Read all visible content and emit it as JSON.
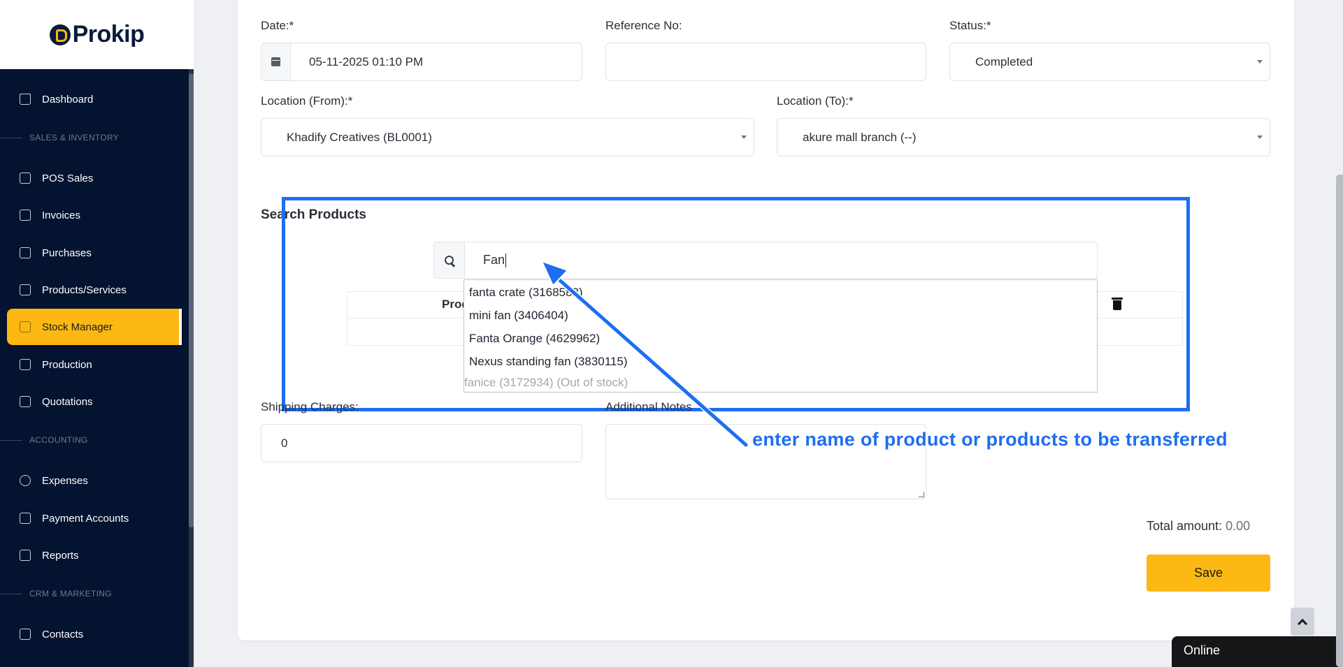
{
  "brand": {
    "name": "Prokip",
    "accent": "#fdb813",
    "sidebar_bg": "#04132f",
    "annotation_color": "#1e6ef0"
  },
  "sidebar": {
    "items": [
      {
        "label": "Dashboard",
        "icon": "home-icon"
      },
      {
        "label": "POS Sales",
        "icon": "shopping-bag-icon"
      },
      {
        "label": "Invoices",
        "icon": "invoice-icon"
      },
      {
        "label": "Purchases",
        "icon": "package-icon"
      },
      {
        "label": "Products/Services",
        "icon": "cube-icon"
      },
      {
        "label": "Stock Manager",
        "icon": "clipboard-icon",
        "active": true
      },
      {
        "label": "Production",
        "icon": "factory-icon"
      },
      {
        "label": "Quotations",
        "icon": "document-icon"
      },
      {
        "label": "Expenses",
        "icon": "pie-chart-icon"
      },
      {
        "label": "Payment Accounts",
        "icon": "credit-card-icon"
      },
      {
        "label": "Reports",
        "icon": "presentation-icon"
      },
      {
        "label": "Contacts",
        "icon": "contacts-icon"
      }
    ],
    "sections": [
      "SALES & INVENTORY",
      "ACCOUNTING",
      "CRM & MARKETING"
    ]
  },
  "form": {
    "date": {
      "label": "Date:*",
      "value": "05-11-2025 01:10 PM"
    },
    "reference": {
      "label": "Reference No:",
      "value": ""
    },
    "status": {
      "label": "Status:*",
      "value": "Completed"
    },
    "location_from": {
      "label": "Location (From):*",
      "value": "Khadify Creatives (BL0001)"
    },
    "location_to": {
      "label": "Location (To):*",
      "value": "akure mall branch (--)"
    },
    "search_title": "Search Products",
    "search_value": "Fan",
    "table_header": "Prod",
    "suggestions": [
      "fanta crate (3168582)",
      "mini fan (3406404)",
      "Fanta Orange (4629962)",
      "Nexus standing fan (3830115)"
    ],
    "suggestion_disabled": "fanice (3172934) (Out of stock)",
    "shipping": {
      "label": "Shipping Charges:",
      "value": "0"
    },
    "notes": {
      "label": "Additional Notes",
      "value": ""
    },
    "total_label": "Total amount:",
    "total_value": "0.00",
    "save_label": "Save"
  },
  "annotation_text": "enter name of product or products to be transferred",
  "chat": {
    "status": "Online"
  }
}
